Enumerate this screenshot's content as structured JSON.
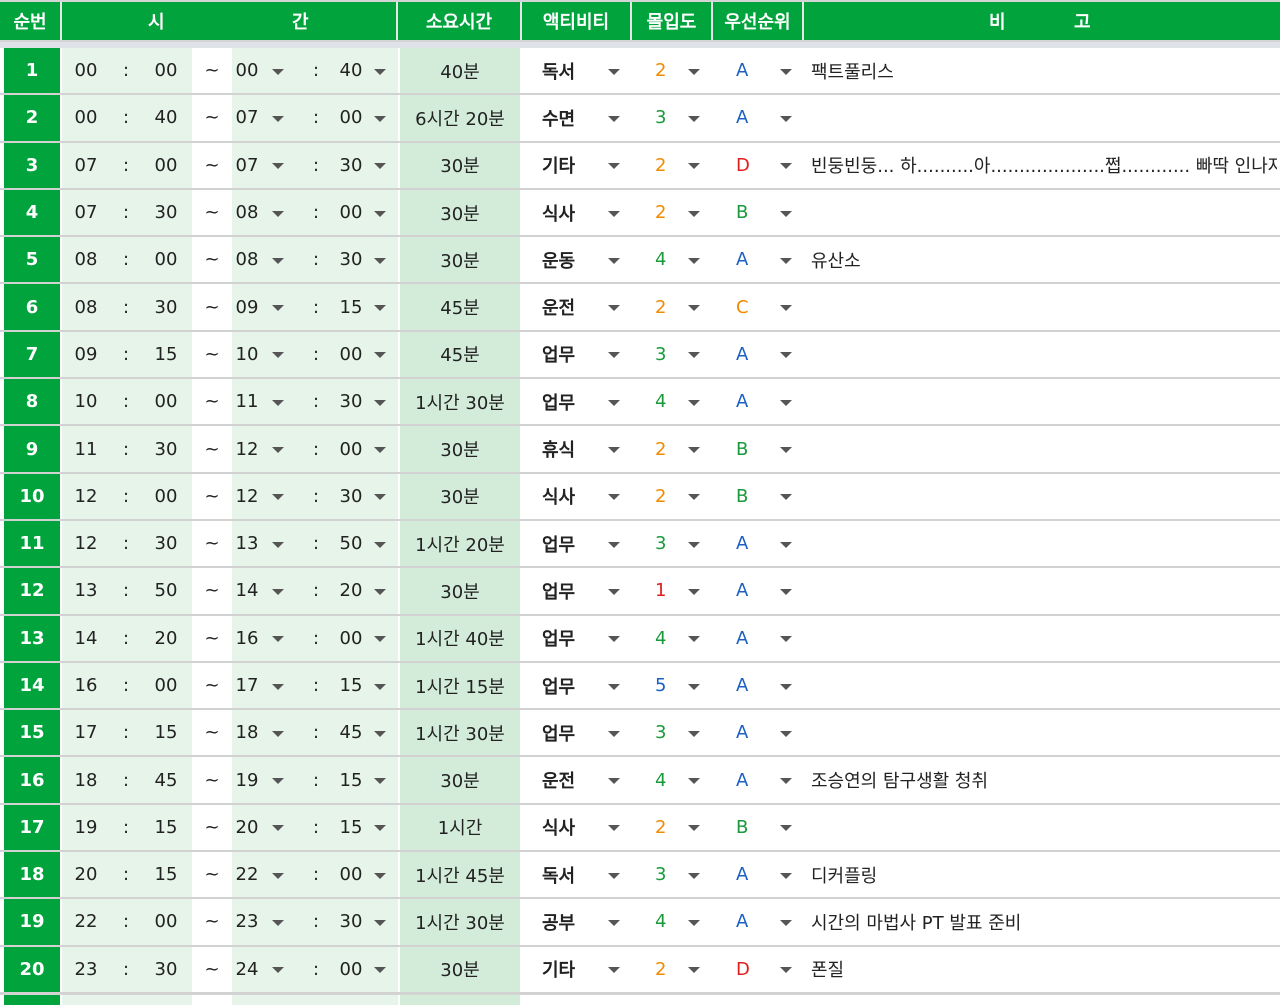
{
  "header": {
    "num": "순번",
    "time_a": "시",
    "time_b": "간",
    "duration": "소요시간",
    "activity": "액티비티",
    "immersion": "몰입도",
    "priority": "우선순위",
    "note_a": "비",
    "note_b": "고"
  },
  "colors": {
    "header_green": "#00a33c",
    "immersion": {
      "1": "#e02020",
      "2": "#f08a00",
      "3": "#1a9a3a",
      "4": "#1a9a3a",
      "5": "#1a5fc4"
    },
    "priority": {
      "A": "#1a5fc4",
      "B": "#1a9a3a",
      "C": "#f08a00",
      "D": "#e02020"
    }
  },
  "rows": [
    {
      "n": "1",
      "sh": "00",
      "sm": "00",
      "eh": "00",
      "em": "40",
      "dur": "40분",
      "act": "독서",
      "imm": "2",
      "pri": "A",
      "note": "팩트풀리스"
    },
    {
      "n": "2",
      "sh": "00",
      "sm": "40",
      "eh": "07",
      "em": "00",
      "dur": "6시간 20분",
      "act": "수면",
      "imm": "3",
      "pri": "A",
      "note": ""
    },
    {
      "n": "3",
      "sh": "07",
      "sm": "00",
      "eh": "07",
      "em": "30",
      "dur": "30분",
      "act": "기타",
      "imm": "2",
      "pri": "D",
      "note": "빈둥빈둥... 하..........아....................쩝............ 빠딱 인나자"
    },
    {
      "n": "4",
      "sh": "07",
      "sm": "30",
      "eh": "08",
      "em": "00",
      "dur": "30분",
      "act": "식사",
      "imm": "2",
      "pri": "B",
      "note": ""
    },
    {
      "n": "5",
      "sh": "08",
      "sm": "00",
      "eh": "08",
      "em": "30",
      "dur": "30분",
      "act": "운동",
      "imm": "4",
      "pri": "A",
      "note": "유산소"
    },
    {
      "n": "6",
      "sh": "08",
      "sm": "30",
      "eh": "09",
      "em": "15",
      "dur": "45분",
      "act": "운전",
      "imm": "2",
      "pri": "C",
      "note": ""
    },
    {
      "n": "7",
      "sh": "09",
      "sm": "15",
      "eh": "10",
      "em": "00",
      "dur": "45분",
      "act": "업무",
      "imm": "3",
      "pri": "A",
      "note": ""
    },
    {
      "n": "8",
      "sh": "10",
      "sm": "00",
      "eh": "11",
      "em": "30",
      "dur": "1시간 30분",
      "act": "업무",
      "imm": "4",
      "pri": "A",
      "note": ""
    },
    {
      "n": "9",
      "sh": "11",
      "sm": "30",
      "eh": "12",
      "em": "00",
      "dur": "30분",
      "act": "휴식",
      "imm": "2",
      "pri": "B",
      "note": ""
    },
    {
      "n": "10",
      "sh": "12",
      "sm": "00",
      "eh": "12",
      "em": "30",
      "dur": "30분",
      "act": "식사",
      "imm": "2",
      "pri": "B",
      "note": ""
    },
    {
      "n": "11",
      "sh": "12",
      "sm": "30",
      "eh": "13",
      "em": "50",
      "dur": "1시간 20분",
      "act": "업무",
      "imm": "3",
      "pri": "A",
      "note": ""
    },
    {
      "n": "12",
      "sh": "13",
      "sm": "50",
      "eh": "14",
      "em": "20",
      "dur": "30분",
      "act": "업무",
      "imm": "1",
      "pri": "A",
      "note": ""
    },
    {
      "n": "13",
      "sh": "14",
      "sm": "20",
      "eh": "16",
      "em": "00",
      "dur": "1시간 40분",
      "act": "업무",
      "imm": "4",
      "pri": "A",
      "note": ""
    },
    {
      "n": "14",
      "sh": "16",
      "sm": "00",
      "eh": "17",
      "em": "15",
      "dur": "1시간 15분",
      "act": "업무",
      "imm": "5",
      "pri": "A",
      "note": ""
    },
    {
      "n": "15",
      "sh": "17",
      "sm": "15",
      "eh": "18",
      "em": "45",
      "dur": "1시간 30분",
      "act": "업무",
      "imm": "3",
      "pri": "A",
      "note": ""
    },
    {
      "n": "16",
      "sh": "18",
      "sm": "45",
      "eh": "19",
      "em": "15",
      "dur": "30분",
      "act": "운전",
      "imm": "4",
      "pri": "A",
      "note": "조승연의 탐구생활 청취"
    },
    {
      "n": "17",
      "sh": "19",
      "sm": "15",
      "eh": "20",
      "em": "15",
      "dur": "1시간",
      "act": "식사",
      "imm": "2",
      "pri": "B",
      "note": ""
    },
    {
      "n": "18",
      "sh": "20",
      "sm": "15",
      "eh": "22",
      "em": "00",
      "dur": "1시간 45분",
      "act": "독서",
      "imm": "3",
      "pri": "A",
      "note": "디커플링"
    },
    {
      "n": "19",
      "sh": "22",
      "sm": "00",
      "eh": "23",
      "em": "30",
      "dur": "1시간 30분",
      "act": "공부",
      "imm": "4",
      "pri": "A",
      "note": "시간의 마법사 PT 발표 준비"
    },
    {
      "n": "20",
      "sh": "23",
      "sm": "30",
      "eh": "24",
      "em": "00",
      "dur": "30분",
      "act": "기타",
      "imm": "2",
      "pri": "D",
      "note": "폰질"
    }
  ],
  "separators": {
    "colon": ":",
    "tilde": "~"
  }
}
